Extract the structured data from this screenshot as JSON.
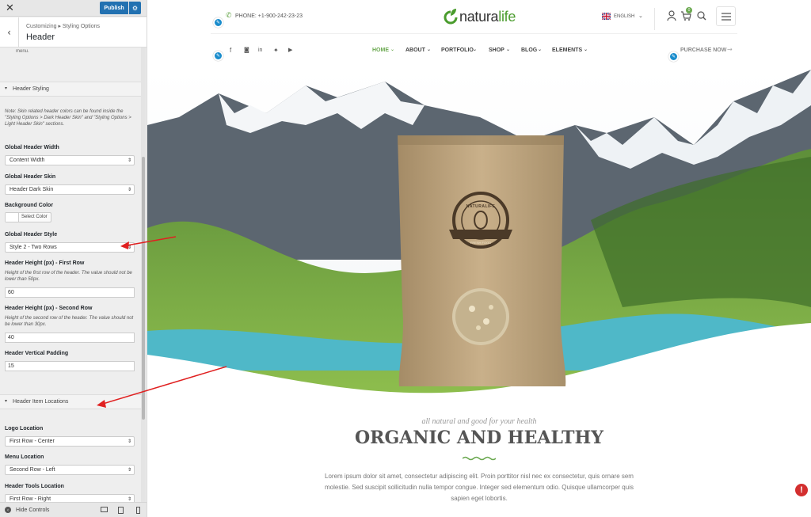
{
  "customizer": {
    "close_icon": "close-icon",
    "publish_label": "Publish",
    "breadcrumb": "Customizing ▸ Styling Options",
    "section_title": "Header",
    "scroll_leftover": "menu.",
    "header_styling": {
      "title": "Header Styling",
      "note": "Note: Skin related header colors can be found inside the \"Styling Options > Dark Header Skin\" and \"Styling Options > Light Header Skin\" sections."
    },
    "fields": {
      "width_label": "Global Header Width",
      "width_value": "Content Width",
      "skin_label": "Global Header Skin",
      "skin_value": "Header Dark Skin",
      "bg_label": "Background Color",
      "bg_button": "Select Color",
      "style_label": "Global Header Style",
      "style_value": "Style 2 - Two Rows",
      "h1_label": "Header Height (px) - First Row",
      "h1_note": "Height of the first row of the header. The value should not be lower than 50px.",
      "h1_value": "60",
      "h2_label": "Header Height (px) - Second Row",
      "h2_note": "Height of the second row of the header. The value should not be lower than 30px.",
      "h2_value": "40",
      "pad_label": "Header Vertical Padding",
      "pad_value": "15"
    },
    "item_locations": {
      "title": "Header Item Locations",
      "logo_label": "Logo Location",
      "logo_value": "First Row - Center",
      "menu_label": "Menu Location",
      "menu_value": "Second Row - Left",
      "tools_label": "Header Tools Location",
      "tools_value": "First Row - Right"
    },
    "hide_controls": "Hide Controls"
  },
  "site": {
    "phone": "PHONE: +1-900-242-23-23",
    "logo_part1": "natura",
    "logo_part2": "life",
    "language": "ENGLISH",
    "cart_count": "0",
    "nav": [
      "HOME",
      "ABOUT",
      "PORTFOLIO",
      "SHOP",
      "BLOG",
      "ELEMENTS"
    ],
    "purchase": "PURCHASE NOW",
    "badge_text": "NATURALIFE",
    "badge_sub": "FRESH FOOD",
    "tagline": "all natural and good for your health",
    "headline": "ORGANIC AND HEALTHY",
    "body_text": "Lorem ipsum dolor sit amet, consectetur adipiscing elit. Proin porttitor nisl nec ex consectetur, quis ornare sem molestie. Sed suscipit sollicitudin nulla tempor congue. Integer sed elementum odio. Quisque ullamcorper quis sapien eget lobortis."
  },
  "colors": {
    "accent_blue": "#2271b1",
    "brand_green": "#4a9c2d",
    "arrow_red": "#e02020"
  }
}
